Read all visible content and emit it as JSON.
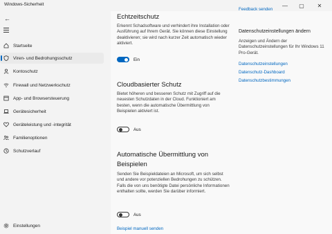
{
  "window": {
    "title": "Windows-Sicherheit",
    "minimize": "—",
    "maximize": "▢",
    "close": "✕"
  },
  "sidebar": {
    "back": "←",
    "items": [
      {
        "label": "Startseite",
        "icon": "home-icon",
        "active": false
      },
      {
        "label": "Viren- und Bedrohungsschutz",
        "icon": "shield-icon",
        "active": true
      },
      {
        "label": "Kontoschutz",
        "icon": "person-icon",
        "active": false
      },
      {
        "label": "Firewall und Netzwerkschutz",
        "icon": "wifi-icon",
        "active": false
      },
      {
        "label": "App- und Browsersteuerung",
        "icon": "app-browser-icon",
        "active": false
      },
      {
        "label": "Gerätesicherheit",
        "icon": "laptop-icon",
        "active": false
      },
      {
        "label": "Geräteleistung und -integrität",
        "icon": "heart-icon",
        "active": false
      },
      {
        "label": "Familienoptionen",
        "icon": "family-icon",
        "active": false
      },
      {
        "label": "Schutzverlauf",
        "icon": "history-icon",
        "active": false
      }
    ],
    "settings": "Einstellungen"
  },
  "main": {
    "top_link": "Feedback senden",
    "realtime": {
      "title": "Echtzeitschutz",
      "desc": "Erkennt Schadsoftware und verhindert ihre Installation oder Ausführung auf Ihrem Gerät. Sie können diese Einstellung deaktivieren; sie wird nach kurzer Zeit automatisch wieder aktiviert.",
      "state": "Ein",
      "on": true
    },
    "cloud": {
      "title": "Cloudbasierter Schutz",
      "desc": "Bietet höheren und besseren Schutz mit Zugriff auf die neuesten Schutzdaten in der Cloud. Funktioniert am besten, wenn die automatische Übermittlung von Beispielen aktiviert ist.",
      "state": "Aus",
      "on": false
    },
    "sample": {
      "title_line1": "Automatische Übermittlung von",
      "title_line2": "Beispielen",
      "desc": "Senden Sie Beispieldateien an Microsoft, um sich selbst und andere vor potenziellen Bedrohungen zu schützen. Falls die von uns benötigte Datei persönliche Informationen enthalten sollte, werden Sie darüber informiert.",
      "state": "Aus",
      "on": false,
      "manual_link": "Beispiel manuell senden"
    }
  },
  "right": {
    "heading": "Datenschutzeinstellungen ändern",
    "desc": "Anzeigen und Ändern der Datenschutzeinstellungen für Ihr Windows 11 Pro-Gerät.",
    "links": [
      "Datenschutzeinstellungen",
      "Datenschutz-Dashboard",
      "Datenschutzbestimmungen"
    ]
  },
  "colors": {
    "accent": "#0067c0",
    "sidebar_bg": "#f3f3f3",
    "content_bg": "#f9f9f9"
  }
}
